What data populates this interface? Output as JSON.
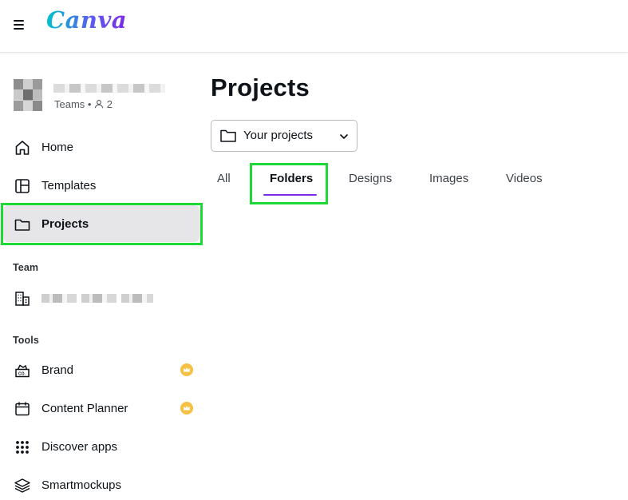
{
  "app": {
    "logo_text": "Canva",
    "accent_color": "#7d2ae8",
    "highlight_color": "#1dd935"
  },
  "account": {
    "meta_label": "Teams •",
    "member_count": "2"
  },
  "sidebar": {
    "items": [
      {
        "label": "Home",
        "icon": "home-icon"
      },
      {
        "label": "Templates",
        "icon": "templates-icon"
      },
      {
        "label": "Projects",
        "icon": "folder-icon",
        "active": true
      }
    ],
    "team_section": {
      "label": "Team"
    },
    "tools_section": {
      "label": "Tools",
      "items": [
        {
          "label": "Brand",
          "icon": "brand-kit-icon",
          "premium": true
        },
        {
          "label": "Content Planner",
          "icon": "calendar-icon",
          "premium": true
        },
        {
          "label": "Discover apps",
          "icon": "apps-grid-icon",
          "premium": false
        },
        {
          "label": "Smartmockups",
          "icon": "layers-icon",
          "premium": false
        }
      ]
    }
  },
  "main": {
    "title": "Projects",
    "filter_dropdown": {
      "selected": "Your projects"
    },
    "tabs": [
      {
        "label": "All"
      },
      {
        "label": "Folders",
        "active": true
      },
      {
        "label": "Designs"
      },
      {
        "label": "Images"
      },
      {
        "label": "Videos"
      }
    ]
  }
}
